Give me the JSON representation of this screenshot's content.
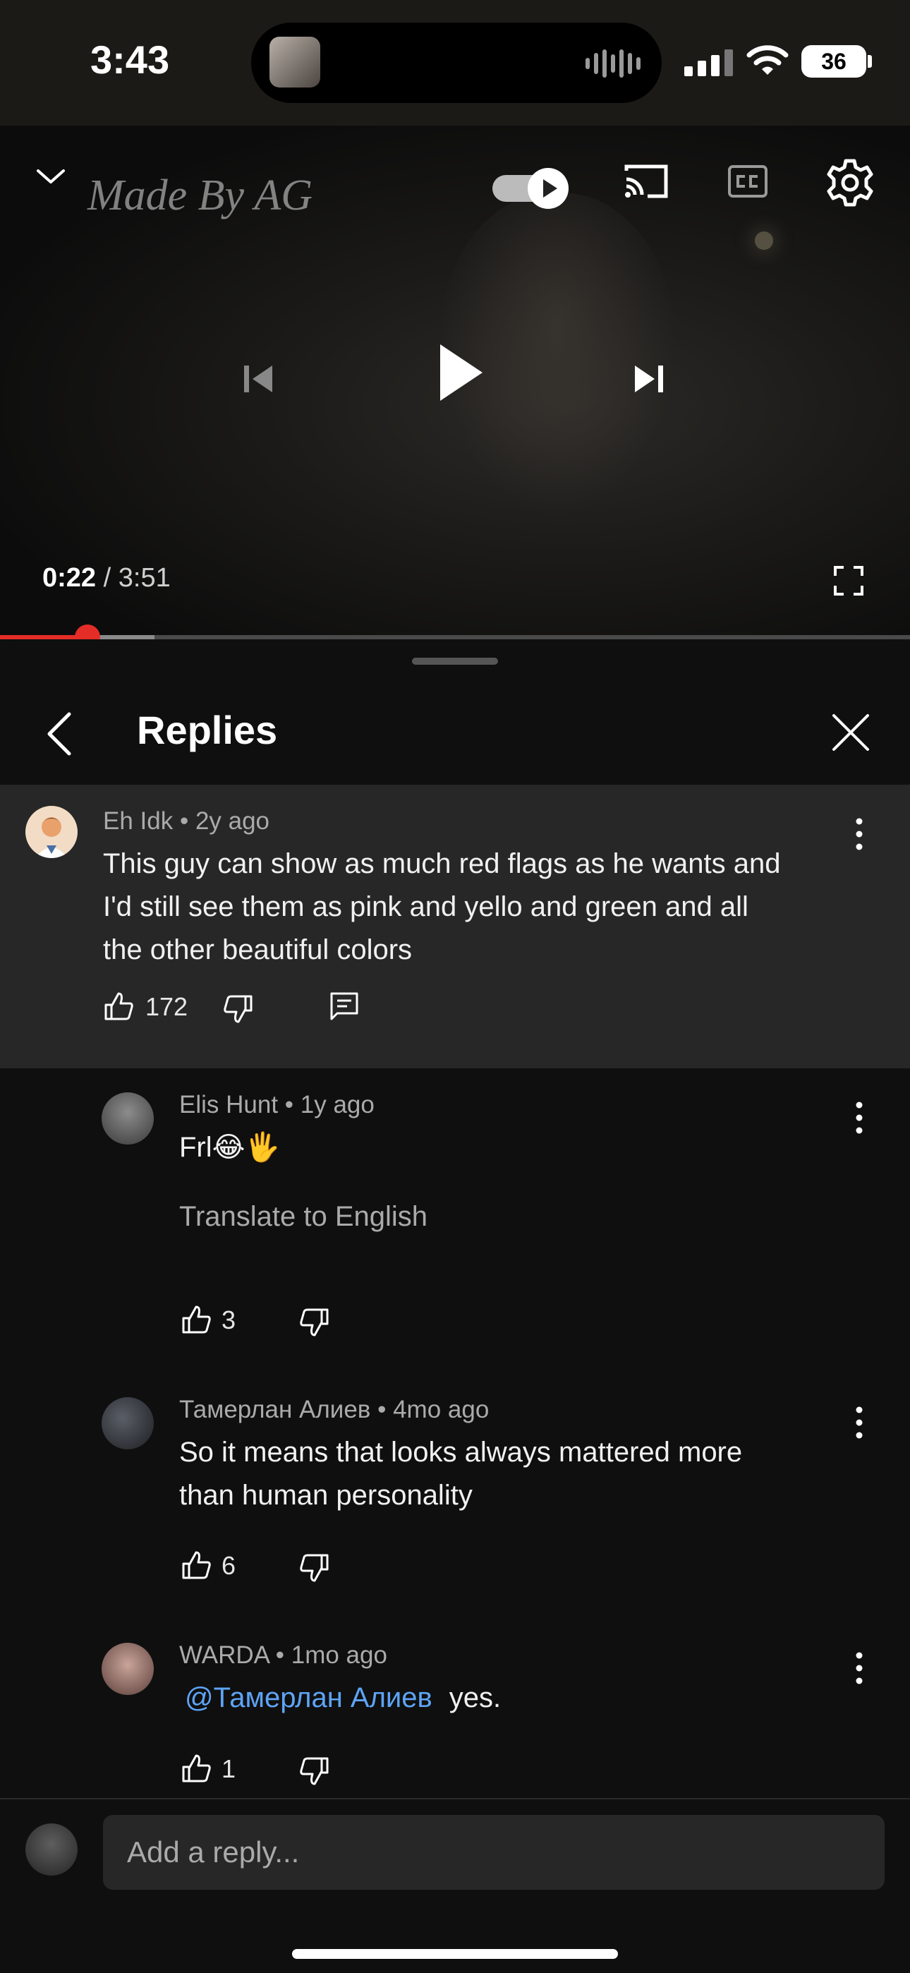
{
  "status_bar": {
    "time": "3:43",
    "battery": "36"
  },
  "player": {
    "watermark": "Made By AG",
    "current_time": "0:22",
    "separator": " / ",
    "duration": "3:51",
    "progress_fraction": 0.096,
    "buffered_fraction": 0.17
  },
  "panel": {
    "title": "Replies"
  },
  "parent_comment": {
    "author": "Eh Idk",
    "age": "2y ago",
    "text_lines": [
      "This guy can show as much red flags as he wants and",
      "I'd still see them as pink and yello and green and all",
      "the other beautiful colors"
    ],
    "likes": "172"
  },
  "replies": [
    {
      "author": "Elis Hunt",
      "age": "1y ago",
      "text": "Frl😂🖐",
      "translate": "Translate to English",
      "likes": "3"
    },
    {
      "author": "Тамерлан Алиев",
      "age": "4mo ago",
      "text_lines": [
        "So it means that looks always mattered more",
        "than human personality"
      ],
      "likes": "6"
    },
    {
      "author": "WARDA",
      "age": "1mo ago",
      "mention": "@Тамерлан Алиев",
      "text": "yes.",
      "likes": "1"
    }
  ],
  "meta_separator": " • ",
  "reply_input": {
    "placeholder": "Add a reply..."
  },
  "colors": {
    "accent_red": "#e52d27",
    "mention_blue": "#5ea4f6",
    "panel_bg": "#0f0f0f",
    "highlight_bg": "#272727"
  }
}
